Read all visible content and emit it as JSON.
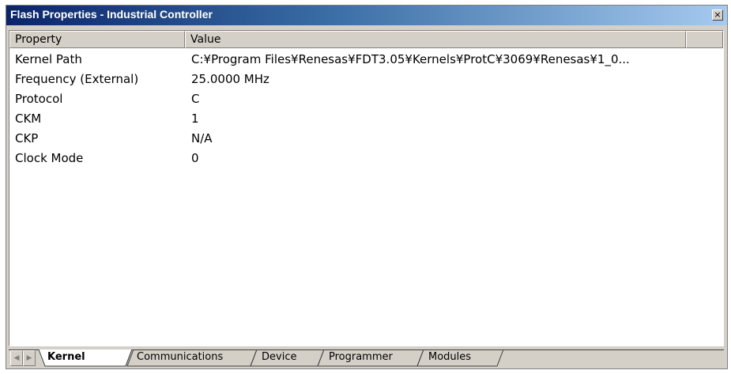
{
  "window": {
    "title": "Flash Properties - Industrial Controller",
    "close_glyph": "×"
  },
  "table": {
    "columns": [
      "Property",
      "Value"
    ],
    "rows": [
      {
        "property": "Kernel Path",
        "value": "C:¥Program Files¥Renesas¥FDT3.05¥Kernels¥ProtC¥3069¥Renesas¥1_0..."
      },
      {
        "property": "Frequency (External)",
        "value": "25.0000 MHz"
      },
      {
        "property": "Protocol",
        "value": "C"
      },
      {
        "property": "CKM",
        "value": "1"
      },
      {
        "property": "CKP",
        "value": "N/A"
      },
      {
        "property": "Clock Mode",
        "value": "0"
      }
    ]
  },
  "tabs": {
    "scroll_left_icon": "◀",
    "scroll_right_icon": "▶",
    "items": [
      {
        "label": "Kernel",
        "active": true
      },
      {
        "label": "Communications",
        "active": false
      },
      {
        "label": "Device",
        "active": false
      },
      {
        "label": "Programmer",
        "active": false
      },
      {
        "label": "Modules",
        "active": false
      }
    ]
  }
}
